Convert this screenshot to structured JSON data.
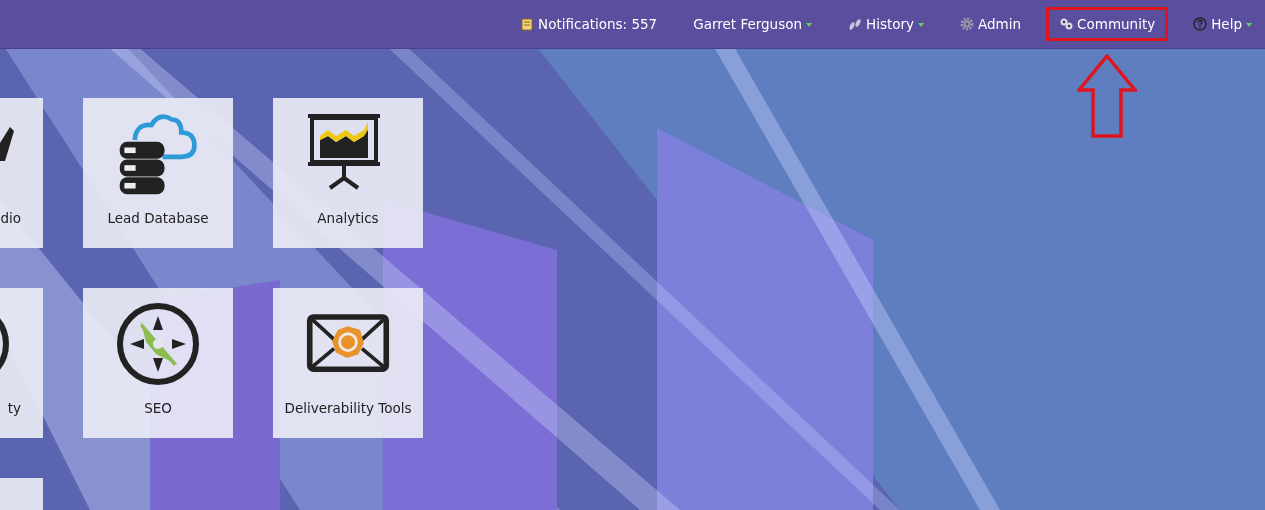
{
  "top_bar": {
    "items": [
      {
        "label": "Notifications: 557",
        "kind": "notebook",
        "dropdown": false,
        "highlighted": false
      },
      {
        "label": "Garret Ferguson",
        "kind": "plain",
        "dropdown": true,
        "highlighted": false
      },
      {
        "label": "History",
        "kind": "footprints",
        "dropdown": true,
        "highlighted": false
      },
      {
        "label": "Admin",
        "kind": "gear",
        "dropdown": false,
        "highlighted": false
      },
      {
        "label": "Community",
        "kind": "people",
        "dropdown": false,
        "highlighted": true
      },
      {
        "label": "Help",
        "kind": "question",
        "dropdown": true,
        "highlighted": false
      }
    ]
  },
  "tiles": [
    {
      "label": "dio",
      "kind": "check"
    },
    {
      "label": "Lead Database",
      "kind": "database"
    },
    {
      "label": "Analytics",
      "kind": "analytics"
    },
    {
      "label": "ty",
      "kind": "ring"
    },
    {
      "label": "SEO",
      "kind": "compass"
    },
    {
      "label": "Deliverability Tools",
      "kind": "envelope"
    },
    {
      "kind": "blank"
    }
  ]
}
